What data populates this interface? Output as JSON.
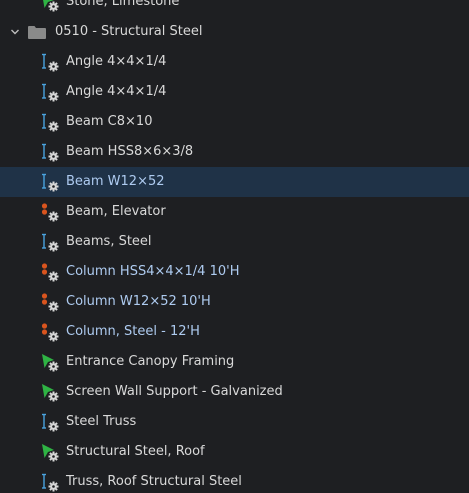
{
  "tree": {
    "partial_item": {
      "label": "Stone, Limestone",
      "icon": "green-flag-gear-icon"
    },
    "group": {
      "label": "0510 - Structural Steel",
      "expanded": true,
      "folder_color": "#8a8a8a"
    },
    "items": [
      {
        "label": "Angle 4×4×1/4",
        "icon": "blue-member-gear-icon",
        "style": "white",
        "selected": false
      },
      {
        "label": "Angle 4×4×1/4",
        "icon": "blue-member-gear-icon",
        "style": "white",
        "selected": false
      },
      {
        "label": "Beam C8×10",
        "icon": "blue-member-gear-icon",
        "style": "white",
        "selected": false
      },
      {
        "label": "Beam HSS8×6×3/8",
        "icon": "blue-member-gear-icon",
        "style": "white",
        "selected": false
      },
      {
        "label": "Beam W12×52",
        "icon": "blue-member-gear-icon",
        "style": "blue",
        "selected": true
      },
      {
        "label": "Beam, Elevator",
        "icon": "orange-dots-gear-icon",
        "style": "white",
        "selected": false
      },
      {
        "label": "Beams, Steel",
        "icon": "blue-member-gear-icon",
        "style": "white",
        "selected": false
      },
      {
        "label": "Column HSS4×4×1/4 10'H",
        "icon": "orange-dots-gear-icon",
        "style": "blue",
        "selected": false
      },
      {
        "label": "Column W12×52 10'H",
        "icon": "orange-dots-gear-icon",
        "style": "blue",
        "selected": false
      },
      {
        "label": "Column, Steel - 12'H",
        "icon": "orange-dots-gear-icon",
        "style": "blue",
        "selected": false
      },
      {
        "label": "Entrance Canopy Framing",
        "icon": "green-flag-gear-icon",
        "style": "white",
        "selected": false
      },
      {
        "label": "Screen Wall Support - Galvanized",
        "icon": "green-flag-gear-icon",
        "style": "white",
        "selected": false
      },
      {
        "label": "Steel Truss",
        "icon": "blue-member-gear-icon",
        "style": "white",
        "selected": false
      },
      {
        "label": "Structural Steel, Roof",
        "icon": "green-flag-gear-icon",
        "style": "white",
        "selected": false
      },
      {
        "label": "Truss, Roof Structural Steel",
        "icon": "blue-member-gear-icon",
        "style": "white",
        "selected": false
      }
    ]
  },
  "colors": {
    "background": "#1e1f22",
    "selected_row": "#1f3247",
    "blue_text": "#aecbf0",
    "white_text": "#d9d9d9",
    "icon_blue": "#4aa3df",
    "icon_orange": "#d9541e",
    "icon_green": "#2fb344",
    "gear": "#d8d8d8"
  }
}
